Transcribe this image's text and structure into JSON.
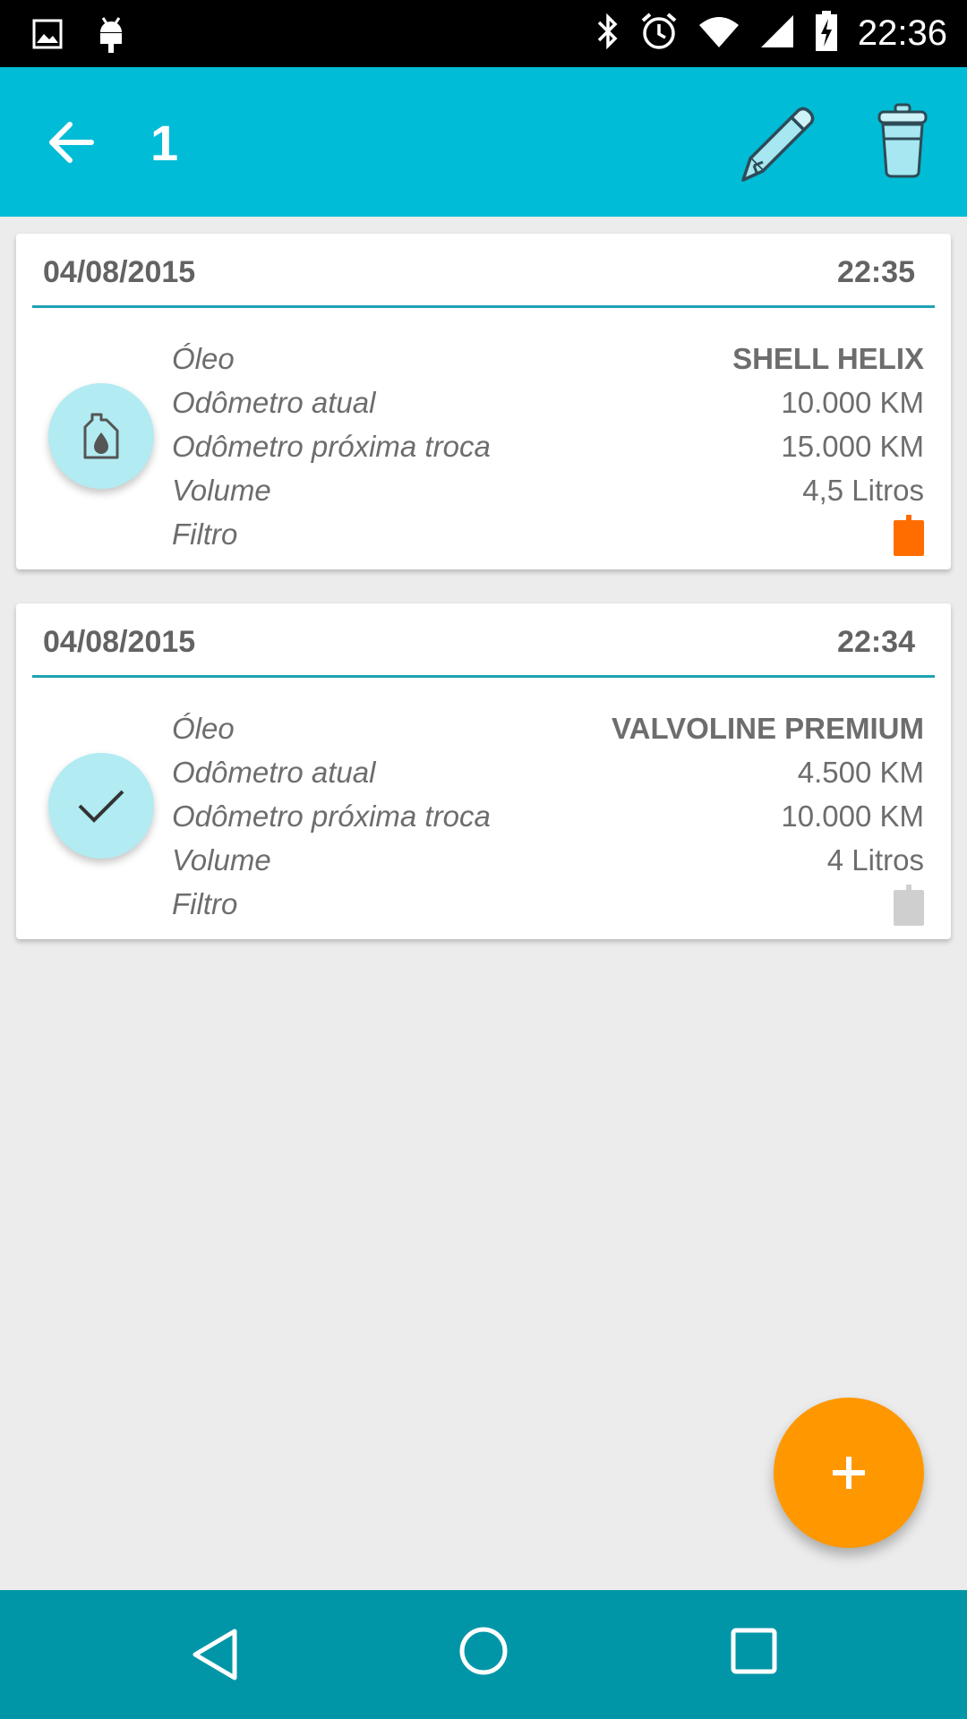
{
  "status_bar": {
    "time": "22:36",
    "icons": [
      "image-icon",
      "android-icon",
      "bluetooth-icon",
      "alarm-icon",
      "wifi-icon",
      "signal-icon",
      "battery-charging-icon"
    ]
  },
  "app_bar": {
    "title": "1",
    "back_icon": "arrow-back-icon",
    "edit_icon": "pencil-icon",
    "delete_icon": "trash-icon"
  },
  "records": [
    {
      "date": "04/08/2015",
      "time": "22:35",
      "status_icon": "oil-bottle-icon",
      "oil_label": "Óleo",
      "oil_value": "SHELL HELIX",
      "odometer_label": "Odômetro atual",
      "odometer_value": "10.000 KM",
      "next_label": "Odômetro próxima troca",
      "next_value": "15.000 KM",
      "volume_label": "Volume",
      "volume_value": "4,5 Litros",
      "filter_label": "Filtro",
      "filter_changed": true,
      "filter_color": "#ff6d00"
    },
    {
      "date": "04/08/2015",
      "time": "22:34",
      "status_icon": "check-icon",
      "oil_label": "Óleo",
      "oil_value": "VALVOLINE PREMIUM",
      "odometer_label": "Odômetro atual",
      "odometer_value": "4.500 KM",
      "next_label": "Odômetro próxima troca",
      "next_value": "10.000 KM",
      "volume_label": "Volume",
      "volume_value": "4 Litros",
      "filter_label": "Filtro",
      "filter_changed": false,
      "filter_color": "#cfcfcf"
    }
  ],
  "fab": {
    "icon": "plus-icon",
    "color": "#ff9800"
  },
  "colors": {
    "app_bar": "#00bcd6",
    "nav_bar": "#0096a7",
    "divider": "#1ea2b4",
    "icon_circle": "#b2ebf2"
  },
  "nav_bar": {
    "icons": [
      "nav-back-icon",
      "nav-home-icon",
      "nav-recents-icon"
    ]
  }
}
